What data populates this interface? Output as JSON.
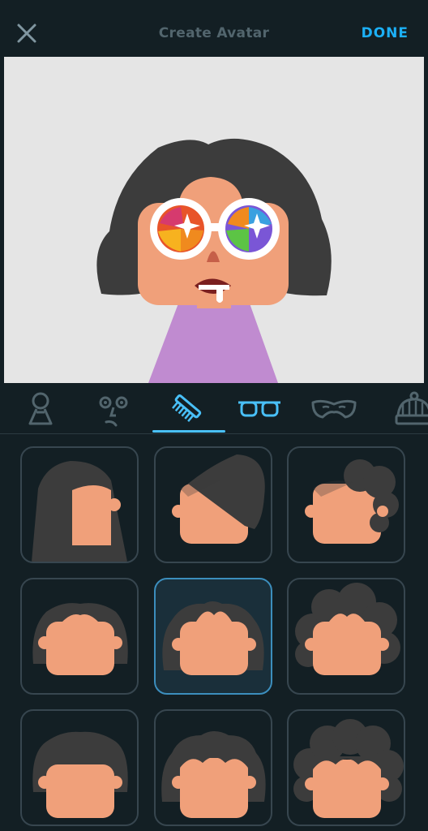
{
  "header": {
    "title": "Create Avatar",
    "done_label": "DONE",
    "close_icon": "close-icon"
  },
  "colors": {
    "background": "#131f24",
    "accent": "#1cb0f6",
    "preview_bg": "#e5e5e5",
    "hair": "#3c3c3c",
    "skin": "#f0a07a",
    "shirt": "#c08bd0",
    "tile_border": "#37464f",
    "tile_selected_border": "#3c8ebd"
  },
  "category_tabs": [
    {
      "icon": "body-icon",
      "selected": false
    },
    {
      "icon": "face-icon",
      "selected": false
    },
    {
      "icon": "comb-icon",
      "selected": true
    },
    {
      "icon": "glasses-icon",
      "selected": false
    },
    {
      "icon": "mustache-icon",
      "selected": false
    },
    {
      "icon": "hat-icon",
      "selected": false
    }
  ],
  "hair_options": [
    {
      "style": "long-straight",
      "selected": false
    },
    {
      "style": "side-swept",
      "selected": false
    },
    {
      "style": "side-curly",
      "selected": false
    },
    {
      "style": "short-bob",
      "selected": false
    },
    {
      "style": "wavy-medium",
      "selected": true
    },
    {
      "style": "curly-volume",
      "selected": false
    },
    {
      "style": "bowl-bangs",
      "selected": false
    },
    {
      "style": "wavy-bangs",
      "selected": false
    },
    {
      "style": "curly-bangs",
      "selected": false
    }
  ]
}
